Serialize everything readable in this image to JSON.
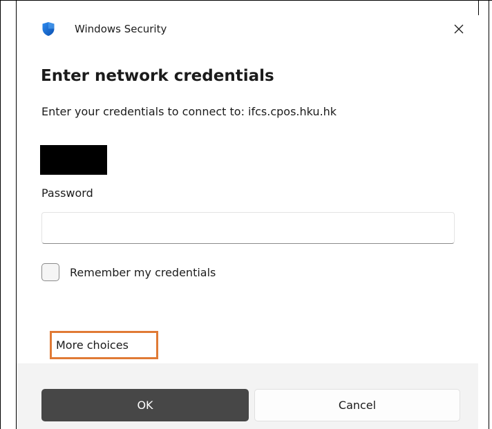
{
  "window": {
    "app_title": "Windows Security",
    "close_icon": "close-icon",
    "app_icon": "shield-icon",
    "accent_color": "#0a64c8"
  },
  "dialog": {
    "heading": "Enter network credentials",
    "subtitle": "Enter your credentials to connect to: ifcs.cpos.hku.hk"
  },
  "form": {
    "username_redacted": true,
    "password_label": "Password",
    "password_value": "",
    "password_placeholder": "",
    "remember_label": "Remember my credentials",
    "remember_checked": false,
    "more_choices_label": "More choices",
    "highlight_color": "#e07a35"
  },
  "footer": {
    "ok_label": "OK",
    "cancel_label": "Cancel",
    "ok_bg_color": "#474747"
  }
}
